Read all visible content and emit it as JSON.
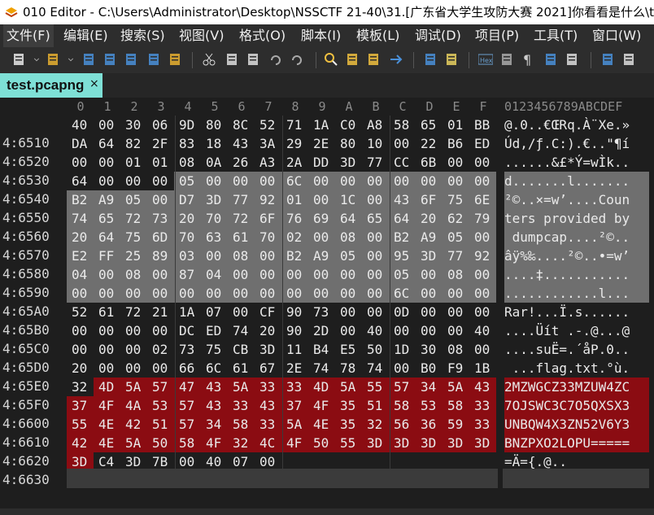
{
  "title": "010 Editor - C:\\Users\\Administrator\\Desktop\\NSSCTF 21-40\\31.[广东省大学生攻防大赛 2021]你看看是什么\\tes",
  "menu": [
    "文件(F)",
    "编辑(E)",
    "搜索(S)",
    "视图(V)",
    "格式(O)",
    "脚本(I)",
    "模板(L)",
    "调试(D)",
    "项目(P)",
    "工具(T)",
    "窗口(W)"
  ],
  "toolbar_icons": [
    "new-file-icon",
    "dropdown-icon",
    "open-folder-icon",
    "dropdown-icon",
    "save-icon",
    "save-as-icon",
    "save-all-icon",
    "close-icon",
    "open-project-icon",
    "cut-icon",
    "copy-icon",
    "paste-icon",
    "undo-icon",
    "redo-icon",
    "find-icon",
    "find-replace-icon",
    "find-in-files-icon",
    "goto-icon",
    "compare-icon",
    "template-icon",
    "hex-icon",
    "script-icon",
    "paragraph-icon",
    "columns-icon",
    "highlight-icon",
    "calculator-icon",
    "checksum-icon"
  ],
  "tab": {
    "label": "test.pcapng",
    "close": "×"
  },
  "columns": [
    "0",
    "1",
    "2",
    "3",
    "4",
    "5",
    "6",
    "7",
    "8",
    "9",
    "A",
    "B",
    "C",
    "D",
    "E",
    "F"
  ],
  "ascii_header": "0123456789ABCDEF",
  "rows": [
    {
      "addr": "4:6510",
      "hex": [
        "40",
        "00",
        "30",
        "06",
        "9D",
        "80",
        "8C",
        "52",
        "71",
        "1A",
        "C0",
        "A8",
        "58",
        "65",
        "01",
        "BB"
      ],
      "ascii": "@.0..€ŒRq.À¨Xe.»"
    },
    {
      "addr": "4:6520",
      "hex": [
        "DA",
        "64",
        "82",
        "2F",
        "83",
        "18",
        "43",
        "3A",
        "29",
        "2E",
        "80",
        "10",
        "00",
        "22",
        "B6",
        "ED"
      ],
      "ascii": "Úd‚/ƒ.C:).€..\"¶í"
    },
    {
      "addr": "4:6530",
      "hex": [
        "00",
        "00",
        "01",
        "01",
        "08",
        "0A",
        "26",
        "A3",
        "2A",
        "DD",
        "3D",
        "77",
        "CC",
        "6B",
        "00",
        "00"
      ],
      "ascii": "......&£*Ý=wÌk.."
    },
    {
      "addr": "4:6540",
      "hex": [
        "64",
        "00",
        "00",
        "00",
        "05",
        "00",
        "00",
        "00",
        "6C",
        "00",
        "00",
        "00",
        "00",
        "00",
        "00",
        "00"
      ],
      "ascii": "d.......l......."
    },
    {
      "addr": "4:6550",
      "hex": [
        "B2",
        "A9",
        "05",
        "00",
        "D7",
        "3D",
        "77",
        "92",
        "01",
        "00",
        "1C",
        "00",
        "43",
        "6F",
        "75",
        "6E"
      ],
      "ascii": "²©..×=w’....Coun"
    },
    {
      "addr": "4:6560",
      "hex": [
        "74",
        "65",
        "72",
        "73",
        "20",
        "70",
        "72",
        "6F",
        "76",
        "69",
        "64",
        "65",
        "64",
        "20",
        "62",
        "79"
      ],
      "ascii": "ters provided by"
    },
    {
      "addr": "4:6570",
      "hex": [
        "20",
        "64",
        "75",
        "6D",
        "70",
        "63",
        "61",
        "70",
        "02",
        "00",
        "08",
        "00",
        "B2",
        "A9",
        "05",
        "00"
      ],
      "ascii": " dumpcap....²©.."
    },
    {
      "addr": "4:6580",
      "hex": [
        "E2",
        "FF",
        "25",
        "89",
        "03",
        "00",
        "08",
        "00",
        "B2",
        "A9",
        "05",
        "00",
        "95",
        "3D",
        "77",
        "92"
      ],
      "ascii": "âÿ%‰....²©..•=w’"
    },
    {
      "addr": "4:6590",
      "hex": [
        "04",
        "00",
        "08",
        "00",
        "87",
        "04",
        "00",
        "00",
        "00",
        "00",
        "00",
        "00",
        "05",
        "00",
        "08",
        "00"
      ],
      "ascii": "....‡..........."
    },
    {
      "addr": "4:65A0",
      "hex": [
        "00",
        "00",
        "00",
        "00",
        "00",
        "00",
        "00",
        "00",
        "00",
        "00",
        "00",
        "00",
        "6C",
        "00",
        "00",
        "00"
      ],
      "ascii": "............l..."
    },
    {
      "addr": "4:65B0",
      "hex": [
        "52",
        "61",
        "72",
        "21",
        "1A",
        "07",
        "00",
        "CF",
        "90",
        "73",
        "00",
        "00",
        "0D",
        "00",
        "00",
        "00"
      ],
      "ascii": "Rar!...Ï.s......"
    },
    {
      "addr": "4:65C0",
      "hex": [
        "00",
        "00",
        "00",
        "00",
        "DC",
        "ED",
        "74",
        "20",
        "90",
        "2D",
        "00",
        "40",
        "00",
        "00",
        "00",
        "40"
      ],
      "ascii": "....Üít .-.@...@"
    },
    {
      "addr": "4:65D0",
      "hex": [
        "00",
        "00",
        "00",
        "02",
        "73",
        "75",
        "CB",
        "3D",
        "11",
        "B4",
        "E5",
        "50",
        "1D",
        "30",
        "08",
        "00"
      ],
      "ascii": "....suË=.´åP.0.."
    },
    {
      "addr": "4:65E0",
      "hex": [
        "20",
        "00",
        "00",
        "00",
        "66",
        "6C",
        "61",
        "67",
        "2E",
        "74",
        "78",
        "74",
        "00",
        "B0",
        "F9",
        "1B"
      ],
      "ascii": " ...flag.txt.°ù."
    },
    {
      "addr": "4:65F0",
      "hex": [
        "32",
        "4D",
        "5A",
        "57",
        "47",
        "43",
        "5A",
        "33",
        "33",
        "4D",
        "5A",
        "55",
        "57",
        "34",
        "5A",
        "43"
      ],
      "ascii": "2MZWGCZ33MZUW4ZC"
    },
    {
      "addr": "4:6600",
      "hex": [
        "37",
        "4F",
        "4A",
        "53",
        "57",
        "43",
        "33",
        "43",
        "37",
        "4F",
        "35",
        "51",
        "58",
        "53",
        "58",
        "33"
      ],
      "ascii": "7OJSWC3C7O5QXSX3"
    },
    {
      "addr": "4:6610",
      "hex": [
        "55",
        "4E",
        "42",
        "51",
        "57",
        "34",
        "58",
        "33",
        "5A",
        "4E",
        "35",
        "32",
        "56",
        "36",
        "59",
        "33"
      ],
      "ascii": "UNBQW4X3ZN52V6Y3"
    },
    {
      "addr": "4:6620",
      "hex": [
        "42",
        "4E",
        "5A",
        "50",
        "58",
        "4F",
        "32",
        "4C",
        "4F",
        "50",
        "55",
        "3D",
        "3D",
        "3D",
        "3D",
        "3D"
      ],
      "ascii": "BNZPXO2LOPU====="
    },
    {
      "addr": "4:6630",
      "hex": [
        "3D",
        "C4",
        "3D",
        "7B",
        "00",
        "40",
        "07",
        "00"
      ],
      "ascii": "=Ä={.@.."
    }
  ],
  "colors": {
    "selection": "#6f6f6f",
    "highlight_red": "#8b0c12",
    "tab": "#7ee0d6"
  }
}
